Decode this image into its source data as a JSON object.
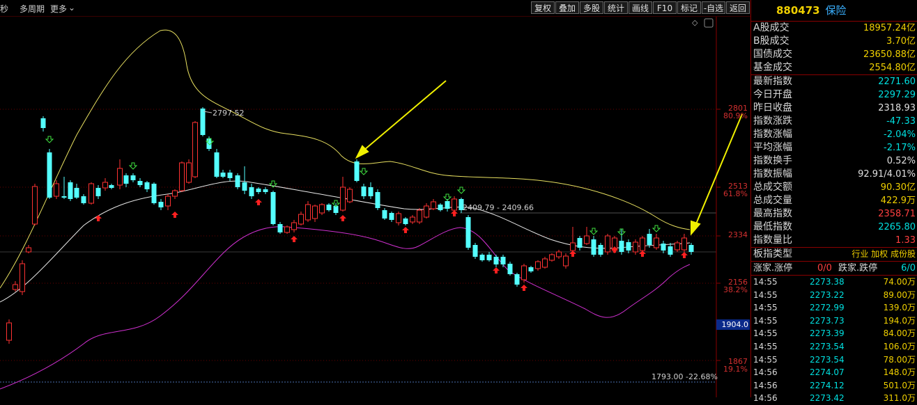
{
  "toolbar": {
    "left_items": [
      "秒",
      "多周期",
      "更多"
    ],
    "buttons": [
      "复权",
      "叠加",
      "多股",
      "统计",
      "画线",
      "F10",
      "标记",
      "-自选",
      "返回"
    ]
  },
  "chart": {
    "high_label": "2797.52",
    "mid_label": "2409.79 - 2409.66",
    "low_label": "1793.00 -22.68%",
    "price_box": "1904.0",
    "axis": [
      {
        "price": "2801",
        "pct": "80.9%"
      },
      {
        "price": "2513",
        "pct": "61.8%"
      },
      {
        "price": "2334",
        "pct": ""
      },
      {
        "price": "2156",
        "pct": "38.2%"
      },
      {
        "price": "1867",
        "pct": "19.1%"
      }
    ]
  },
  "panel": {
    "code": "880473",
    "name": "保险",
    "volumes": [
      {
        "k": "A股成交",
        "v": "18957.24亿",
        "c": "#f0d000"
      },
      {
        "k": "B股成交",
        "v": "3.70亿",
        "c": "#f0d000"
      },
      {
        "k": "国债成交",
        "v": "23650.88亿",
        "c": "#f0d000"
      },
      {
        "k": "基金成交",
        "v": "2554.80亿",
        "c": "#f0d000"
      }
    ],
    "stats": [
      {
        "k": "最新指数",
        "v": "2271.60",
        "c": "#00e0e0"
      },
      {
        "k": "今日开盘",
        "v": "2297.29",
        "c": "#00e0e0"
      },
      {
        "k": "昨日收盘",
        "v": "2318.93",
        "c": "#e0e0e0"
      },
      {
        "k": "指数涨跌",
        "v": "-47.33",
        "c": "#00e0e0"
      },
      {
        "k": "指数涨幅",
        "v": "-2.04%",
        "c": "#00e0e0"
      },
      {
        "k": "平均涨幅",
        "v": "-2.17%",
        "c": "#00e0e0"
      },
      {
        "k": "指数换手",
        "v": "0.52%",
        "c": "#e0e0e0"
      },
      {
        "k": "指数振幅",
        "v": "92.91/4.01%",
        "c": "#e0e0e0"
      },
      {
        "k": "总成交额",
        "v": "90.30亿",
        "c": "#f0d000"
      },
      {
        "k": "总成交量",
        "v": "422.9万",
        "c": "#f0d000"
      },
      {
        "k": "最高指数",
        "v": "2358.71",
        "c": "#ff4040"
      },
      {
        "k": "最低指数",
        "v": "2265.80",
        "c": "#00e0e0"
      },
      {
        "k": "指数量比",
        "v": "1.33",
        "c": "#ff4040"
      }
    ],
    "type_label": "板指类型",
    "type_values": "行业 加权 成份股",
    "limit_up_label": "涨家.涨停",
    "limit_up_value": "0/0",
    "limit_down_label": "跌家.跌停",
    "limit_down_value": "6/0",
    "ticks": [
      {
        "t": "14:55",
        "p": "2273.38",
        "v": "74.00万"
      },
      {
        "t": "14:55",
        "p": "2273.22",
        "v": "89.00万"
      },
      {
        "t": "14:55",
        "p": "2272.99",
        "v": "139.0万"
      },
      {
        "t": "14:55",
        "p": "2273.73",
        "v": "194.0万"
      },
      {
        "t": "14:55",
        "p": "2273.39",
        "v": "84.00万"
      },
      {
        "t": "14:55",
        "p": "2273.54",
        "v": "106.0万"
      },
      {
        "t": "14:55",
        "p": "2273.54",
        "v": "78.00万"
      },
      {
        "t": "14:56",
        "p": "2274.07",
        "v": "148.0万"
      },
      {
        "t": "14:56",
        "p": "2274.12",
        "v": "501.0万"
      },
      {
        "t": "14:56",
        "p": "2273.42",
        "v": "311.0万"
      }
    ]
  }
}
